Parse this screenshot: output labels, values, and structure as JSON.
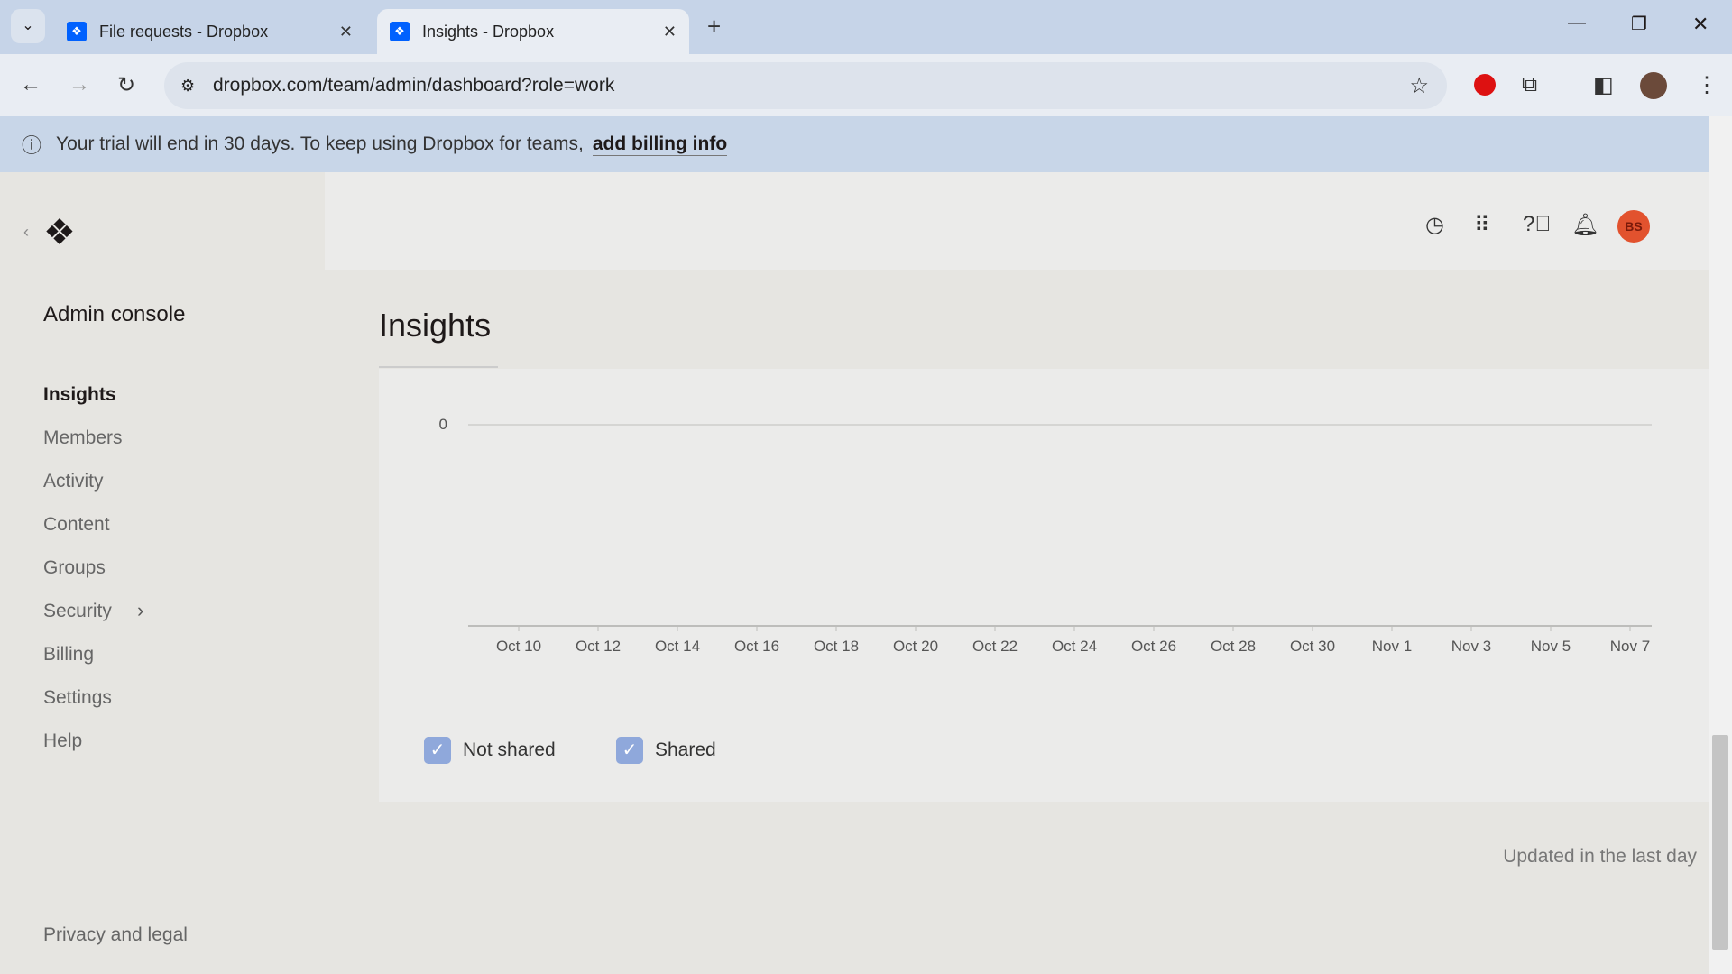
{
  "browser": {
    "tabs": [
      {
        "title": "File requests - Dropbox",
        "active": false
      },
      {
        "title": "Insights - Dropbox",
        "active": true
      }
    ],
    "url": "dropbox.com/team/admin/dashboard?role=work"
  },
  "banner": {
    "text": "Your trial will end in 30 days. To keep using Dropbox for teams,",
    "link": "add billing info"
  },
  "header": {
    "avatar_initials": "BS",
    "avatar_color": "#e2522e"
  },
  "sidebar": {
    "title": "Admin console",
    "items": [
      {
        "label": "Insights",
        "active": true
      },
      {
        "label": "Members"
      },
      {
        "label": "Activity"
      },
      {
        "label": "Content"
      },
      {
        "label": "Groups"
      },
      {
        "label": "Security",
        "chevron": true
      },
      {
        "label": "Billing"
      },
      {
        "label": "Settings"
      },
      {
        "label": "Help"
      }
    ],
    "footer": "Privacy and legal"
  },
  "main": {
    "title": "Insights",
    "updated": "Updated in the last day"
  },
  "chart_data": {
    "type": "line",
    "y_ticks": [
      "0"
    ],
    "x_ticks": [
      "Oct 10",
      "Oct 12",
      "Oct 14",
      "Oct 16",
      "Oct 18",
      "Oct 20",
      "Oct 22",
      "Oct 24",
      "Oct 26",
      "Oct 28",
      "Oct 30",
      "Nov 1",
      "Nov 3",
      "Nov 5",
      "Nov 7"
    ],
    "series": [
      {
        "name": "Not shared",
        "values": []
      },
      {
        "name": "Shared",
        "values": []
      }
    ],
    "legend": [
      {
        "label": "Not shared",
        "checked": true
      },
      {
        "label": "Shared",
        "checked": true
      }
    ],
    "legend_placement": "bottom-left"
  }
}
